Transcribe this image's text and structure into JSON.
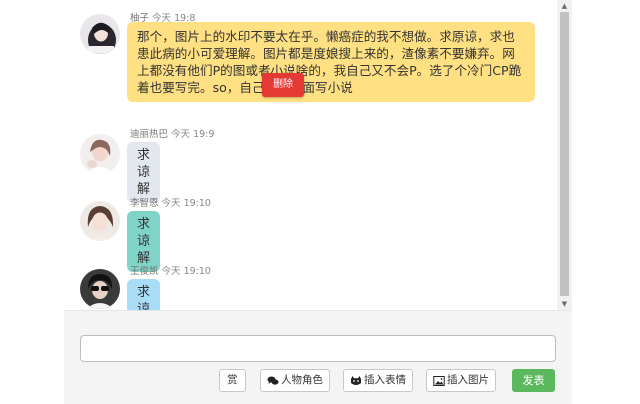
{
  "messages": [
    {
      "name": "柚子",
      "time": "今天 19:8",
      "text": "那个，图片上的水印不要太在乎。懒癌症的我不想做。求原谅，求也患此病的小可爱理解。图片都是度娘搜上来的，渣像素不要嫌弃。网上都没有他们P的图或者小说啥的，我自己又不会P。选了个冷门CP跪着也要写完。so，自己脑补画面写小说",
      "color": "#ffe082"
    },
    {
      "name": "迪丽热巴",
      "time": "今天 19:9",
      "text": "求谅解",
      "color": "#e3e8ef"
    },
    {
      "name": "李智恩",
      "time": "今天 19:10",
      "text": "求谅解",
      "color": "#7fd3c7"
    },
    {
      "name": "王俊凯",
      "time": "今天 19:10",
      "text": "求谅解",
      "color": "#a9dcf7"
    }
  ],
  "context_menu": {
    "delete_label": "删除"
  },
  "composer": {
    "input_value": "",
    "buttons": {
      "reward": "赏",
      "role": "人物角色",
      "emoji": "插入表情",
      "image": "插入图片",
      "send": "发表"
    }
  },
  "colors": {
    "send": "#5cb85c",
    "delete": "#e53935"
  }
}
